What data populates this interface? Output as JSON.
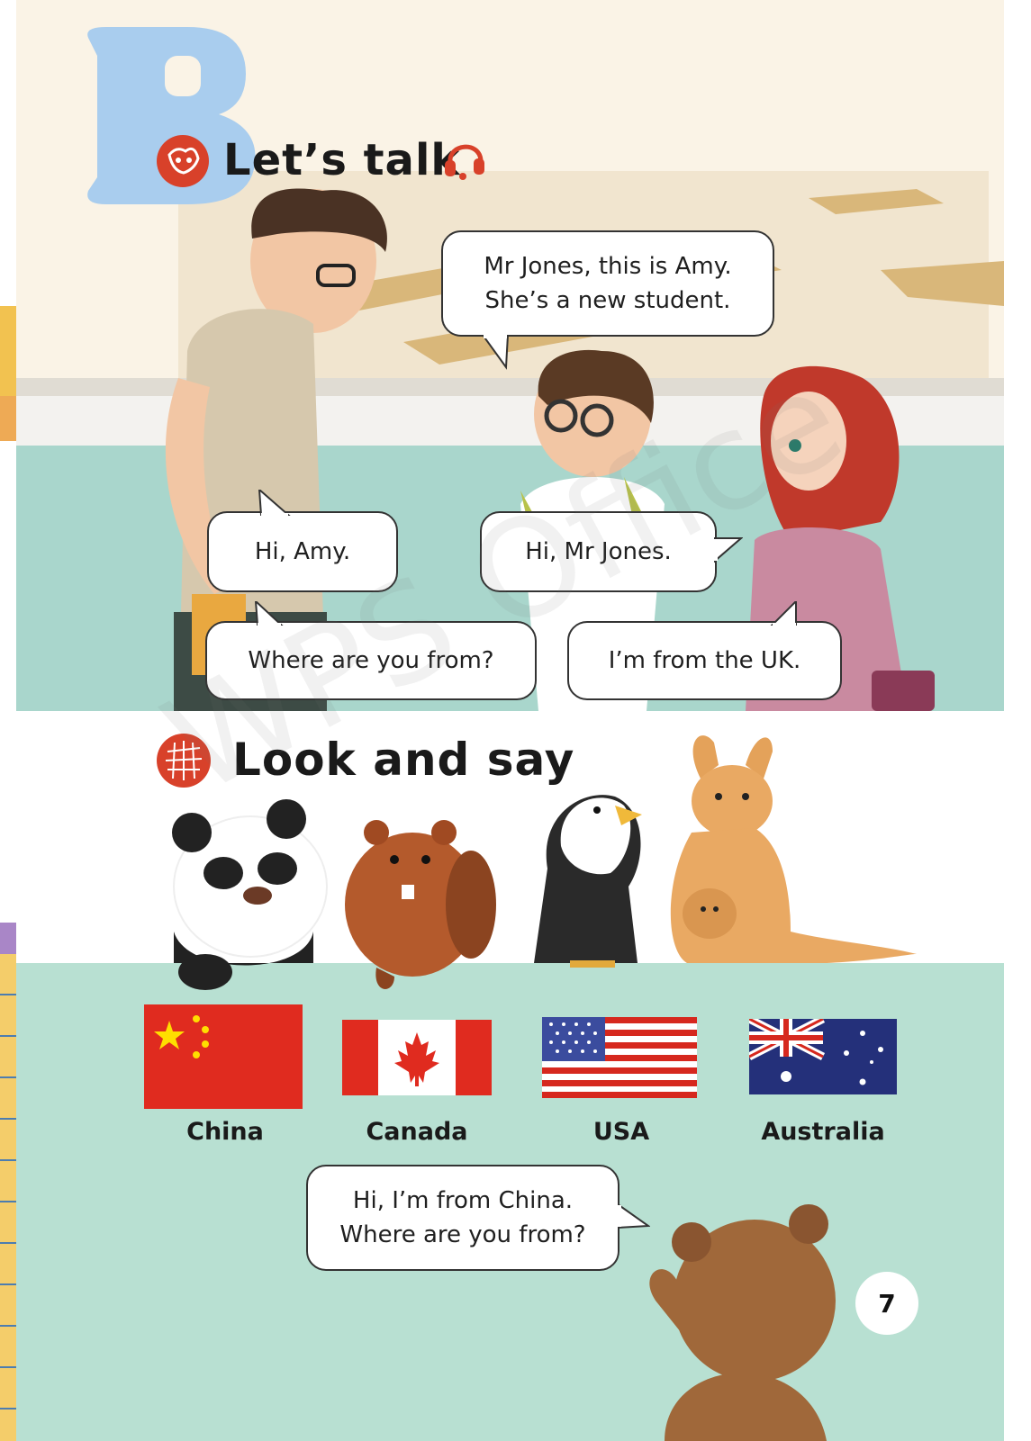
{
  "section_letter": "B",
  "lets_talk": {
    "title": "Let’s talk",
    "bubbles": {
      "intro_line1": "Mr Jones, this is Amy.",
      "intro_line2": "She’s a new student.",
      "hi_amy": "Hi, Amy.",
      "hi_mr_jones": "Hi, Mr Jones.",
      "where_from": "Where are you from?",
      "from_uk": "I’m from the UK."
    }
  },
  "look_and_say": {
    "title": "Look and say",
    "flags": [
      {
        "label": "China"
      },
      {
        "label": "Canada"
      },
      {
        "label": "USA"
      },
      {
        "label": "Australia"
      }
    ],
    "bubble_line1": "Hi, I’m from China.",
    "bubble_line2": "Where are you from?"
  },
  "page_number": "7",
  "watermark": "WPS Office",
  "colors": {
    "letter_blue": "#a9cdee",
    "icon_red": "#d8412a",
    "floor_teal": "#a9d6cc",
    "bottom_teal": "#b8e0d2",
    "side_yellow": "#f2c250",
    "side_purple": "#a986c7"
  }
}
